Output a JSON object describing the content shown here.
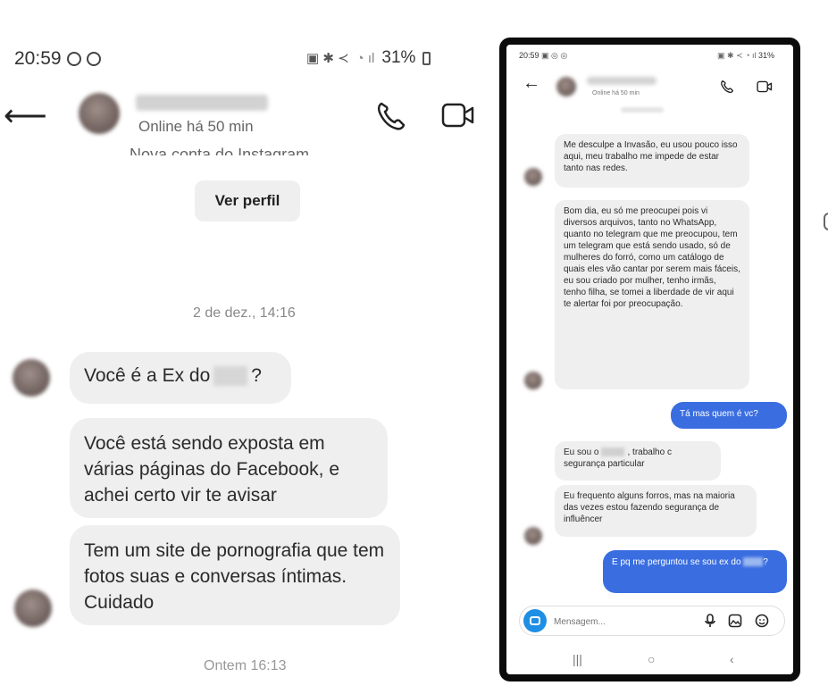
{
  "left": {
    "status": {
      "time": "20:59",
      "battery": "31%"
    },
    "header": {
      "online_text": "Online há 50 min"
    },
    "new_account_text": "Nova conta do Instagram",
    "ver_perfil_label": "Ver perfil",
    "date_divider_1": "2 de dez., 14:16",
    "messages": {
      "m1_before": "Você é a Ex do",
      "m1_after": "?",
      "m2": "Você está sendo exposta em várias páginas do Facebook, e achei certo vir te avisar",
      "m3": "Tem um site de pornografia que tem fotos suas e conversas íntimas. Cuidado"
    },
    "date_divider_2": "Ontem 16:13"
  },
  "right": {
    "status": {
      "time": "20:59",
      "battery": "31%"
    },
    "header": {
      "online_text": "Online há 50 min"
    },
    "messages": {
      "r1": "Me desculpe a Invasão, eu usou pouco isso aqui, meu trabalho me impede de estar tanto nas redes.",
      "r2": "Bom dia, eu só me preocupei pois vi diversos arquivos, tanto no WhatsApp, quanto no telegram que me preocupou, tem um telegram que está sendo usado, só de mulheres do forró, como um catálogo de quais eles vão cantar por serem mais fáceis, eu sou criado por mulher, tenho irmãs, tenho filha, se tomei a liberdade de vir aqui te alertar foi por preocupação.",
      "r3": "Tá mas quem é vc?",
      "r4_before": "Eu sou o",
      "r4_after": ", trabalho c segurança particular",
      "r5": "Eu frequento alguns forros, mas na maioria das vezes estou fazendo segurança de influêncer",
      "r6_before": "E pq me perguntou se sou ex do",
      "r6_after": "?"
    },
    "composer": {
      "placeholder": "Mensagem..."
    },
    "icons": [
      "camera-icon",
      "microphone-icon",
      "gallery-icon",
      "sticker-icon"
    ]
  },
  "colors": {
    "sent_bubble": "#3a6ee0",
    "received_bubble": "#efefef",
    "camera_button": "#1f8fe5"
  }
}
